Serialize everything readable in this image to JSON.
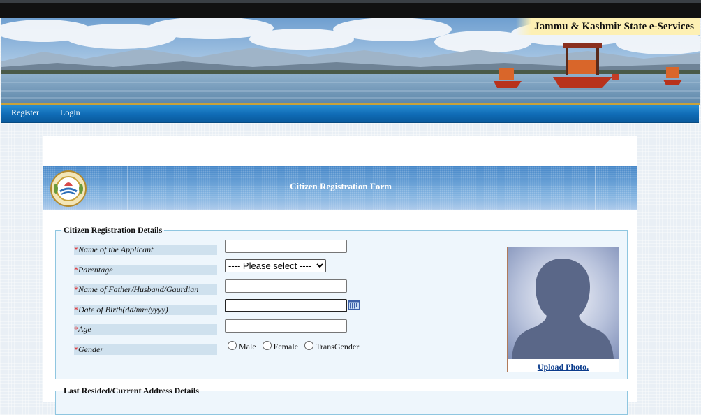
{
  "header": {
    "site_title": "Jammu & Kashmir State e-Services"
  },
  "nav": {
    "register": "Register",
    "login": "Login"
  },
  "form": {
    "title": "Citizen Registration Form",
    "section1_legend": "Citizen Registration Details",
    "section2_legend": "Last Resided/Current Address Details",
    "required_mark": "*",
    "fields": {
      "applicant_name_label": "Name of the Applicant",
      "parentage_label": "Parentage",
      "parentage_selected": "---- Please select ----",
      "father_name_label": "Name of Father/Husband/Gaurdian",
      "dob_label": "Date of Birth(dd/mm/yyyy)",
      "age_label": "Age",
      "gender_label": "Gender"
    },
    "gender_options": [
      "Male",
      "Female",
      "TransGender"
    ],
    "upload_photo": "Upload Photo."
  },
  "colors": {
    "nav_blue": "#0f6bb5",
    "label_bg": "#cfe1ee",
    "required_red": "#e02020",
    "link_blue": "#0b3c8c"
  },
  "icons": [
    "calendar-icon",
    "state-emblem",
    "avatar-placeholder"
  ]
}
